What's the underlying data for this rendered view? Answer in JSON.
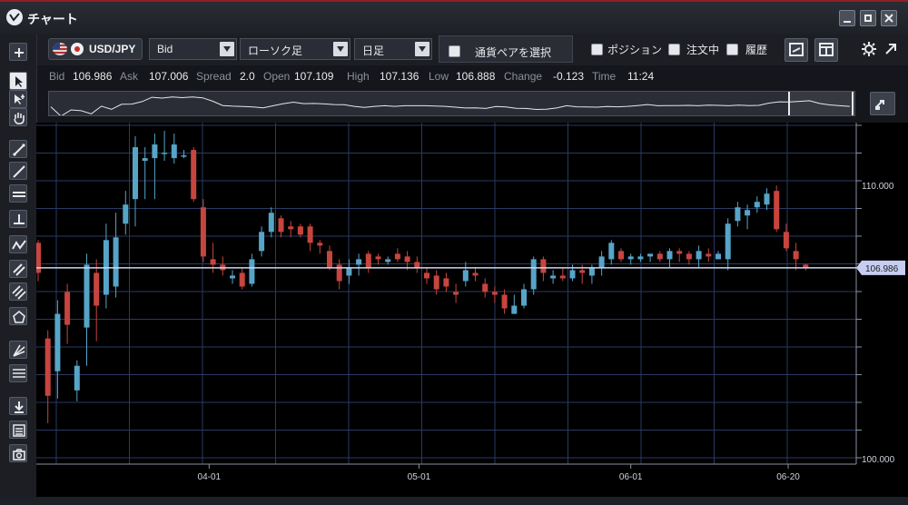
{
  "window": {
    "title": "チャート"
  },
  "toolbar": {
    "pair": "USD/JPY",
    "price_type": "Bid",
    "chart_type": "ローソク足",
    "period": "日足",
    "pair_select_label": "通貨ペアを選択",
    "checks": [
      {
        "label": "ポジション",
        "checked": false
      },
      {
        "label": "注文中",
        "checked": false
      },
      {
        "label": "履歴",
        "checked": false
      }
    ]
  },
  "quote": {
    "bid_label": "Bid",
    "bid": "106.986",
    "ask_label": "Ask",
    "ask": "107.006",
    "spread_label": "Spread",
    "spread": "2.0",
    "open_label": "Open",
    "open": "107.109",
    "high_label": "High",
    "high": "107.136",
    "low_label": "Low",
    "low": "106.888",
    "change_label": "Change",
    "change": "-0.123",
    "time_label": "Time",
    "time": "11:24"
  },
  "colors": {
    "up": "#56a5c8",
    "down": "#c7453f",
    "grid": "#2a3a63",
    "price_line": "#cfd6ee",
    "price_tag": "#c7cdf0"
  },
  "chart_data": {
    "type": "candlestick",
    "symbol": "USD/JPY",
    "current_price": 106.986,
    "y_ticks": [
      {
        "value": 110.0,
        "label": "110.000"
      },
      {
        "value": 100.0,
        "label": "100.000"
      }
    ],
    "ylim": [
      99.8,
      112.3
    ],
    "x_ticks": [
      {
        "index": 17.6,
        "label": "04-01"
      },
      {
        "index": 39.2,
        "label": "05-01"
      },
      {
        "index": 61.0,
        "label": "06-01"
      },
      {
        "index": 77.2,
        "label": "06-20"
      }
    ],
    "grid": true,
    "candles": [
      [
        107.9,
        106.8,
        108.0,
        106.5
      ],
      [
        104.4,
        102.3,
        104.7,
        101.3
      ],
      [
        103.2,
        105.3,
        105.8,
        102.2
      ],
      [
        106.1,
        104.9,
        106.4,
        104.2
      ],
      [
        102.5,
        103.4,
        103.6,
        102.1
      ],
      [
        104.8,
        107.1,
        107.5,
        103.4
      ],
      [
        106.8,
        105.6,
        107.3,
        104.3
      ],
      [
        106.0,
        108.0,
        108.6,
        105.5
      ],
      [
        106.3,
        108.1,
        109.0,
        105.9
      ],
      [
        108.6,
        109.3,
        109.8,
        108.2
      ],
      [
        109.5,
        111.4,
        111.8,
        108.5
      ],
      [
        110.9,
        111.0,
        111.4,
        109.5
      ],
      [
        111.0,
        111.5,
        111.9,
        109.5
      ],
      [
        111.2,
        111.2,
        112.0,
        110.9
      ],
      [
        111.0,
        111.5,
        111.9,
        110.8
      ],
      [
        111.1,
        111.1,
        111.3,
        111.0
      ],
      [
        111.3,
        109.5,
        111.4,
        109.4
      ],
      [
        109.2,
        107.4,
        109.5,
        107.2
      ],
      [
        107.3,
        107.1,
        107.9,
        106.8
      ],
      [
        107.1,
        106.9,
        107.4,
        106.7
      ],
      [
        106.6,
        106.7,
        106.9,
        106.4
      ],
      [
        106.8,
        106.3,
        107.0,
        106.2
      ],
      [
        106.4,
        107.3,
        107.5,
        106.3
      ],
      [
        107.6,
        108.3,
        108.5,
        107.4
      ],
      [
        108.3,
        109.0,
        109.2,
        108.1
      ],
      [
        108.8,
        108.3,
        108.9,
        108.1
      ],
      [
        108.5,
        108.4,
        108.7,
        108.1
      ],
      [
        108.5,
        108.2,
        108.6,
        108.1
      ],
      [
        108.5,
        107.9,
        108.6,
        107.6
      ],
      [
        107.9,
        107.8,
        108.0,
        107.5
      ],
      [
        107.6,
        107.0,
        107.8,
        106.9
      ],
      [
        107.1,
        106.5,
        107.3,
        106.2
      ],
      [
        106.7,
        107.0,
        107.3,
        106.4
      ],
      [
        107.1,
        107.3,
        107.5,
        106.7
      ],
      [
        107.5,
        107.0,
        107.6,
        106.8
      ],
      [
        107.4,
        107.3,
        107.5,
        107.1
      ],
      [
        107.2,
        107.3,
        107.4,
        107.1
      ],
      [
        107.5,
        107.3,
        107.7,
        107.2
      ],
      [
        107.4,
        107.2,
        107.6,
        106.9
      ],
      [
        107.2,
        107.0,
        107.4,
        106.8
      ],
      [
        106.8,
        106.6,
        107.0,
        106.4
      ],
      [
        106.7,
        106.2,
        106.9,
        106.0
      ],
      [
        106.6,
        106.3,
        106.8,
        106.1
      ],
      [
        106.1,
        106.0,
        106.4,
        105.7
      ],
      [
        106.5,
        106.9,
        107.2,
        106.3
      ],
      [
        106.8,
        106.7,
        107.0,
        106.5
      ],
      [
        106.4,
        106.1,
        106.6,
        105.9
      ],
      [
        106.1,
        106.0,
        106.3,
        105.7
      ],
      [
        106.0,
        105.5,
        106.2,
        105.3
      ],
      [
        105.3,
        105.6,
        106.0,
        105.3
      ],
      [
        105.6,
        106.2,
        106.4,
        105.5
      ],
      [
        106.2,
        107.3,
        107.4,
        106.0
      ],
      [
        107.3,
        106.8,
        107.4,
        106.5
      ],
      [
        106.6,
        106.7,
        106.9,
        106.4
      ],
      [
        106.7,
        106.6,
        107.0,
        106.5
      ],
      [
        106.6,
        106.9,
        107.1,
        106.5
      ],
      [
        106.9,
        106.8,
        107.1,
        106.4
      ],
      [
        106.7,
        107.0,
        107.1,
        106.4
      ],
      [
        107.0,
        107.4,
        107.6,
        106.7
      ],
      [
        107.3,
        107.9,
        108.0,
        107.1
      ],
      [
        107.6,
        107.3,
        107.7,
        107.2
      ],
      [
        107.3,
        107.4,
        107.5,
        107.1
      ],
      [
        107.3,
        107.4,
        107.5,
        107.2
      ],
      [
        107.4,
        107.5,
        107.5,
        107.2
      ],
      [
        107.5,
        107.3,
        107.6,
        107.2
      ],
      [
        107.3,
        107.6,
        107.7,
        107.0
      ],
      [
        107.6,
        107.5,
        107.7,
        107.2
      ],
      [
        107.5,
        107.3,
        107.6,
        107.1
      ],
      [
        107.3,
        107.6,
        107.8,
        107.0
      ],
      [
        107.5,
        107.4,
        107.7,
        107.2
      ],
      [
        107.3,
        107.5,
        107.6,
        107.3
      ],
      [
        107.3,
        108.6,
        108.8,
        106.9
      ],
      [
        108.7,
        109.2,
        109.4,
        108.5
      ],
      [
        108.9,
        109.1,
        109.3,
        108.4
      ],
      [
        109.2,
        109.4,
        109.6,
        109.0
      ],
      [
        109.3,
        109.7,
        109.9,
        109.1
      ],
      [
        109.8,
        108.4,
        110.0,
        108.3
      ],
      [
        108.3,
        107.7,
        108.6,
        107.6
      ],
      [
        107.6,
        107.3,
        107.9,
        106.9
      ],
      [
        107.1,
        106.99,
        107.14,
        106.89
      ]
    ]
  }
}
